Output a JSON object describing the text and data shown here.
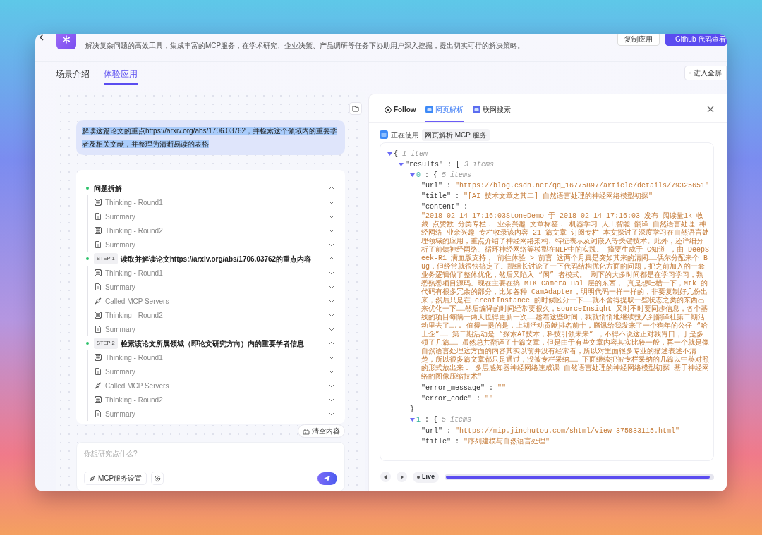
{
  "app": {
    "description": "解决复杂问题的高效工具，集成丰富的MCP服务，在学术研究、企业决策、产品调研等任务下协助用户深入挖掘，提出切实可行的解决策略。",
    "actions": [
      {
        "label": "复制应用",
        "kind": "secondary"
      },
      {
        "label": "Github 代码查看",
        "kind": "github"
      }
    ]
  },
  "page_tabs": [
    {
      "label": "场景介绍",
      "selected": false
    },
    {
      "label": "体验应用",
      "selected": true
    }
  ],
  "fullscreen_button": "进入全屏",
  "chat": {
    "user_message": {
      "text": "解读这篇论文的重点https://arxiv.org/abs/1706.03762，并检索这个领域内的重要学者及相关文献，并整理为清晰易读的表格",
      "highlighted": true
    },
    "steps": [
      {
        "title": "问题拆解",
        "expanded": true,
        "items": [
          {
            "kind": "thinking",
            "label": "Thinking - Round1",
            "expanded": false
          },
          {
            "kind": "summary",
            "label": "Summary",
            "expanded": false
          },
          {
            "kind": "thinking",
            "label": "Thinking - Round2",
            "expanded": false
          },
          {
            "kind": "summary",
            "label": "Summary",
            "expanded": false
          }
        ]
      },
      {
        "badge": "STEP 1",
        "title": "读取并解读论文https://arxiv.org/abs/1706.03762的重点内容",
        "expanded": true,
        "items": [
          {
            "kind": "thinking",
            "label": "Thinking - Round1",
            "expanded": false
          },
          {
            "kind": "summary",
            "label": "Summary",
            "expanded": false
          },
          {
            "kind": "mcp",
            "label": "Called MCP Servers",
            "expanded": false
          },
          {
            "kind": "thinking",
            "label": "Thinking - Round2",
            "expanded": false
          },
          {
            "kind": "summary",
            "label": "Summary",
            "expanded": false
          }
        ]
      },
      {
        "badge": "STEP 2",
        "title": "检索该论文所属领域（即论文研究方向）内的重要学者信息",
        "expanded": true,
        "items": [
          {
            "kind": "thinking",
            "label": "Thinking - Round1",
            "expanded": false
          },
          {
            "kind": "summary",
            "label": "Summary",
            "expanded": false
          },
          {
            "kind": "mcp",
            "label": "Called MCP Servers",
            "expanded": false
          },
          {
            "kind": "thinking",
            "label": "Thinking - Round2",
            "expanded": false
          },
          {
            "kind": "summary",
            "label": "Summary",
            "expanded": false
          }
        ]
      }
    ],
    "clear_button": "清空内容",
    "input": {
      "placeholder": "你想研究点什么?",
      "mcp_button": "MCP服务设置"
    }
  },
  "inspector": {
    "tabs": [
      {
        "kind": "follow",
        "label": "Follow",
        "selected": false
      },
      {
        "kind": "service",
        "label": "网页解析",
        "selected": true
      },
      {
        "kind": "service",
        "label": "联网搜索",
        "selected": false
      }
    ],
    "status_label": "正在使用",
    "service_tag": "网页解析 MCP 服务",
    "separator": ":",
    "json_tree": {
      "open": "{",
      "summary": "1 item",
      "expanded": true,
      "children": [
        {
          "key": "\"results\"",
          "open": "[",
          "summary": "3 items",
          "expanded": true,
          "children": [
            {
              "key": "0",
              "open": "{",
              "summary": "5 items",
              "expanded": true,
              "close": "}",
              "children": [
                {
                  "key": "\"url\"",
                  "value": "\"https://blog.csdn.net/qq_16775897/article/details/79325651\""
                },
                {
                  "key": "\"title\"",
                  "value": "\"[AI 技术文章之其二] 自然语言处理的神经网络模型初探\""
                },
                {
                  "key": "\"content\"",
                  "kind": "block",
                  "value": "\"2018-02-14 17:16:03StoneDemo 于 2018-02-14 17:16:03 发布 阅读量1k 收藏 点赞数 分类专栏： 业余兴趣 文章标签： 机器学习 人工智能 翻译 自然语言处理 神经网络 业余兴趣 专栏收录该内容 21 篇文章 订阅专栏 本文探讨了深度学习在自然语言处理领域的应用，重点介绍了神经网络架构、特征表示及词嵌入等关键技术。此外，还详细分析了前馈神经网络、循环神经网络等模型在NLP中的实践。 摘要生成于 C知道 ，由 DeepSeek-R1 满血版支持， 前往体验 > 前言 这两个月真是突如其来的清闲……偶尔分配来个 Bug，但经常就很快搞定了。跟组长讨论了一下代码结构优化方面的问题，把之前加入的一套业务逻辑做了整体优化，然后又陷入 “闲” 者模式。 剩下的大多时间都是在学习学习，熟悉熟悉项目源码。现在主要在搞 MTK Camera Hal 层的东西， 真是想吐槽一下，Mtk 的代码有很多冗余的部分，比如各种 CamAdapter，明明代码一样一样的，非要复制好几份出来，然后只是在 creatInstance 的时候区分一下……就不舍得提取一些状态之类的东西出来优化一下……然后编译的时间经常要很久，sourceInsight 又时不时要同步信息，各个基线的项目每隔一两天也得更新一次……趁着这些时间，我就悄悄地继续投入到翻译社第二期活动里去了….. 值得一提的是，上期活动贡献排名前十，腾讯给我发来了一个狗年的公仔 “哈士企”…… 第二期活动是 “探索AI技术，科技引领未来” ，不得不说这正对我胃口，于是多领了几篇…… 虽然总共翻译了十篇文章，但是由于有些文章内容其实比较一般，再一个就是像自然语言处理这方面的内容其实以前并没有经常看，所以对里面很多专业的描述表述不清楚，所以很多篇文章都只是通过，没被专栏采纳…… 下面继续把被专栏采纳的几篇以中英对照的形式放出来： 多层感知器神经网络速成课 自然语言处理的神经网络模型初探 基于神经网络的图像压缩技术\""
                },
                {
                  "key": "\"error_message\"",
                  "value": "\"\""
                },
                {
                  "key": "\"error_code\"",
                  "value": "\"\""
                }
              ]
            },
            {
              "key": "1",
              "open": "{",
              "summary": "5 items",
              "expanded": true,
              "children": [
                {
                  "key": "\"url\"",
                  "value": "\"https://mip.jinchutou.com/shtml/view-375833115.html\""
                },
                {
                  "key": "\"title\"",
                  "value": "\"序列建模与自然语言处理\""
                }
              ]
            }
          ]
        }
      ]
    },
    "player": {
      "live_label": "Live",
      "level": 1
    }
  }
}
